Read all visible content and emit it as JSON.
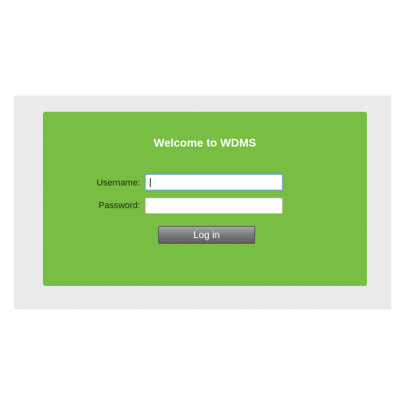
{
  "login": {
    "title": "Welcome to WDMS",
    "username_label": "Username:",
    "username_value": "",
    "password_label": "Password:",
    "password_value": "",
    "login_button": "Log in"
  },
  "colors": {
    "panel_background": "#78be43",
    "title_text": "#ffffff",
    "button_gradient_top": "#a9a9a9",
    "button_gradient_bottom": "#5e5e5e",
    "focus_border": "#7cb7e6"
  },
  "focus": "username"
}
